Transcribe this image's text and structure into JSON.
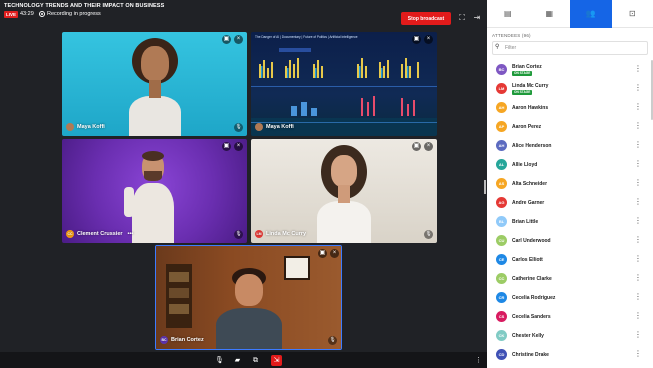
{
  "header": {
    "title": "TECHNOLOGY TRENDS AND THEIR IMPACT ON BUSINESS",
    "live": "LIVE",
    "timer": "43:29",
    "recording": "Recording in progress",
    "stop_broadcast": "Stop broadcast"
  },
  "tiles": [
    {
      "name": "Maya Koffi",
      "initials": "",
      "color": "#2bb6d6"
    },
    {
      "name": "Maya Koffi",
      "initials": "",
      "shared": "The Danger of AI | Documentary | Future of Politics | Artificial Intelligence"
    },
    {
      "name": "Clement Crussier",
      "initials": "CC",
      "color": "#f39c12"
    },
    {
      "name": "Linda Mc Curry",
      "initials": "LM",
      "color": "#e53935"
    },
    {
      "name": "Brian Cortez",
      "initials": "BC",
      "color": "#5e35b1"
    }
  ],
  "sidebar": {
    "attendees_header": "ATTENDEES (96)",
    "filter_placeholder": "Filter",
    "attendees": [
      {
        "initials": "BC",
        "name": "Brian Cortez",
        "badge": "ON STAGE",
        "color": "#7e57c2"
      },
      {
        "initials": "LM",
        "name": "Linda Mc Curry",
        "badge": "ON STAGE",
        "color": "#e53935"
      },
      {
        "initials": "AH",
        "name": "Aaron Hawkins",
        "badge": "",
        "color": "#f6a623"
      },
      {
        "initials": "AP",
        "name": "Aaron Perez",
        "badge": "",
        "color": "#f6a623"
      },
      {
        "initials": "AH",
        "name": "Alice Henderson",
        "badge": "",
        "color": "#5c6bc0"
      },
      {
        "initials": "AL",
        "name": "Allie Lloyd",
        "badge": "",
        "color": "#26a69a"
      },
      {
        "initials": "AS",
        "name": "Alta Schneider",
        "badge": "",
        "color": "#f6a623"
      },
      {
        "initials": "AG",
        "name": "Andre Garner",
        "badge": "",
        "color": "#e53935"
      },
      {
        "initials": "BL",
        "name": "Brian Little",
        "badge": "",
        "color": "#90caf9"
      },
      {
        "initials": "CU",
        "name": "Carl Underwood",
        "badge": "",
        "color": "#9ccc65"
      },
      {
        "initials": "CE",
        "name": "Carlos Elliott",
        "badge": "",
        "color": "#1e88e5"
      },
      {
        "initials": "CC",
        "name": "Catherine Clarke",
        "badge": "",
        "color": "#9ccc65"
      },
      {
        "initials": "CR",
        "name": "Cecelia Rodriguez",
        "badge": "",
        "color": "#1e88e5"
      },
      {
        "initials": "CS",
        "name": "Cecelia Sanders",
        "badge": "",
        "color": "#d81b60"
      },
      {
        "initials": "CK",
        "name": "Chester Kelly",
        "badge": "",
        "color": "#80cbc4"
      },
      {
        "initials": "CD",
        "name": "Christine Drake",
        "badge": "",
        "color": "#3f51b5"
      }
    ]
  }
}
